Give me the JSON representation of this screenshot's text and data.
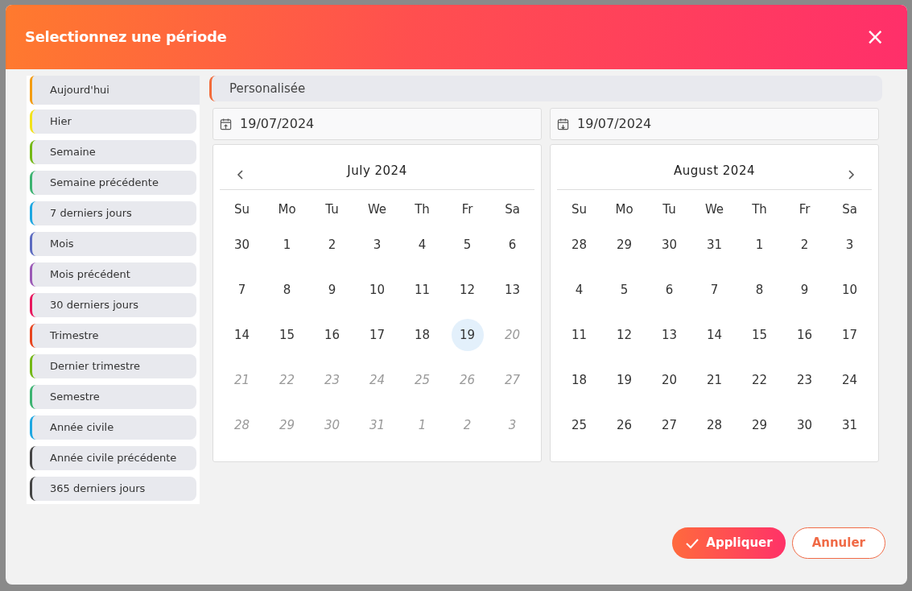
{
  "dialog": {
    "title": "Selectionnez une période",
    "close": "×"
  },
  "presets": [
    {
      "label": "Aujourd'hui",
      "color": "#f39c12",
      "selected": true
    },
    {
      "label": "Hier",
      "color": "#f2e21a",
      "selected": false
    },
    {
      "label": "Semaine",
      "color": "#74b816",
      "selected": false
    },
    {
      "label": "Semaine précédente",
      "color": "#3cb371",
      "selected": false
    },
    {
      "label": "7 derniers jours",
      "color": "#1ea7e1",
      "selected": false
    },
    {
      "label": "Mois",
      "color": "#5c6bc0",
      "selected": false
    },
    {
      "label": "Mois précédent",
      "color": "#9b59b6",
      "selected": false
    },
    {
      "label": "30 derniers jours",
      "color": "#e8175d",
      "selected": false
    },
    {
      "label": "Trimestre",
      "color": "#e8451e",
      "selected": false
    },
    {
      "label": "Dernier trimestre",
      "color": "#74b816",
      "selected": false
    },
    {
      "label": "Semestre",
      "color": "#3cb371",
      "selected": false
    },
    {
      "label": "Année civile",
      "color": "#1ea7e1",
      "selected": false
    },
    {
      "label": "Année civile précédente",
      "color": "#444444",
      "selected": false
    },
    {
      "label": "365 derniers jours",
      "color": "#444444",
      "selected": false
    }
  ],
  "custom": {
    "label": "Personalisée",
    "color": "#f26b3a"
  },
  "date_fields": [
    {
      "kind": "start",
      "value": "19/07/2024"
    },
    {
      "kind": "end",
      "value": "19/07/2024"
    }
  ],
  "calendars": [
    {
      "title": "July 2024",
      "prev_button": true,
      "next_button": false,
      "weekdays": [
        "Su",
        "Mo",
        "Tu",
        "We",
        "Th",
        "Fr",
        "Sa"
      ],
      "weeks": [
        [
          {
            "label": "30",
            "muted": false,
            "selected": false
          },
          {
            "label": "1",
            "muted": false,
            "selected": false
          },
          {
            "label": "2",
            "muted": false,
            "selected": false
          },
          {
            "label": "3",
            "muted": false,
            "selected": false
          },
          {
            "label": "4",
            "muted": false,
            "selected": false
          },
          {
            "label": "5",
            "muted": false,
            "selected": false
          },
          {
            "label": "6",
            "muted": false,
            "selected": false
          }
        ],
        [
          {
            "label": "7",
            "muted": false,
            "selected": false
          },
          {
            "label": "8",
            "muted": false,
            "selected": false
          },
          {
            "label": "9",
            "muted": false,
            "selected": false
          },
          {
            "label": "10",
            "muted": false,
            "selected": false
          },
          {
            "label": "11",
            "muted": false,
            "selected": false
          },
          {
            "label": "12",
            "muted": false,
            "selected": false
          },
          {
            "label": "13",
            "muted": false,
            "selected": false
          }
        ],
        [
          {
            "label": "14",
            "muted": false,
            "selected": false
          },
          {
            "label": "15",
            "muted": false,
            "selected": false
          },
          {
            "label": "16",
            "muted": false,
            "selected": false
          },
          {
            "label": "17",
            "muted": false,
            "selected": false
          },
          {
            "label": "18",
            "muted": false,
            "selected": false
          },
          {
            "label": "19",
            "muted": false,
            "selected": true
          },
          {
            "label": "20",
            "muted": true,
            "selected": false
          }
        ],
        [
          {
            "label": "21",
            "muted": true,
            "selected": false
          },
          {
            "label": "22",
            "muted": true,
            "selected": false
          },
          {
            "label": "23",
            "muted": true,
            "selected": false
          },
          {
            "label": "24",
            "muted": true,
            "selected": false
          },
          {
            "label": "25",
            "muted": true,
            "selected": false
          },
          {
            "label": "26",
            "muted": true,
            "selected": false
          },
          {
            "label": "27",
            "muted": true,
            "selected": false
          }
        ],
        [
          {
            "label": "28",
            "muted": true,
            "selected": false
          },
          {
            "label": "29",
            "muted": true,
            "selected": false
          },
          {
            "label": "30",
            "muted": true,
            "selected": false
          },
          {
            "label": "31",
            "muted": true,
            "selected": false
          },
          {
            "label": "1",
            "muted": true,
            "selected": false
          },
          {
            "label": "2",
            "muted": true,
            "selected": false
          },
          {
            "label": "3",
            "muted": true,
            "selected": false
          }
        ]
      ]
    },
    {
      "title": "August 2024",
      "prev_button": false,
      "next_button": true,
      "weekdays": [
        "Su",
        "Mo",
        "Tu",
        "We",
        "Th",
        "Fr",
        "Sa"
      ],
      "weeks": [
        [
          {
            "label": "28",
            "muted": false,
            "selected": false
          },
          {
            "label": "29",
            "muted": false,
            "selected": false
          },
          {
            "label": "30",
            "muted": false,
            "selected": false
          },
          {
            "label": "31",
            "muted": false,
            "selected": false
          },
          {
            "label": "1",
            "muted": false,
            "selected": false
          },
          {
            "label": "2",
            "muted": false,
            "selected": false
          },
          {
            "label": "3",
            "muted": false,
            "selected": false
          }
        ],
        [
          {
            "label": "4",
            "muted": false,
            "selected": false
          },
          {
            "label": "5",
            "muted": false,
            "selected": false
          },
          {
            "label": "6",
            "muted": false,
            "selected": false
          },
          {
            "label": "7",
            "muted": false,
            "selected": false
          },
          {
            "label": "8",
            "muted": false,
            "selected": false
          },
          {
            "label": "9",
            "muted": false,
            "selected": false
          },
          {
            "label": "10",
            "muted": false,
            "selected": false
          }
        ],
        [
          {
            "label": "11",
            "muted": false,
            "selected": false
          },
          {
            "label": "12",
            "muted": false,
            "selected": false
          },
          {
            "label": "13",
            "muted": false,
            "selected": false
          },
          {
            "label": "14",
            "muted": false,
            "selected": false
          },
          {
            "label": "15",
            "muted": false,
            "selected": false
          },
          {
            "label": "16",
            "muted": false,
            "selected": false
          },
          {
            "label": "17",
            "muted": false,
            "selected": false
          }
        ],
        [
          {
            "label": "18",
            "muted": false,
            "selected": false
          },
          {
            "label": "19",
            "muted": false,
            "selected": false
          },
          {
            "label": "20",
            "muted": false,
            "selected": false
          },
          {
            "label": "21",
            "muted": false,
            "selected": false
          },
          {
            "label": "22",
            "muted": false,
            "selected": false
          },
          {
            "label": "23",
            "muted": false,
            "selected": false
          },
          {
            "label": "24",
            "muted": false,
            "selected": false
          }
        ],
        [
          {
            "label": "25",
            "muted": false,
            "selected": false
          },
          {
            "label": "26",
            "muted": false,
            "selected": false
          },
          {
            "label": "27",
            "muted": false,
            "selected": false
          },
          {
            "label": "28",
            "muted": false,
            "selected": false
          },
          {
            "label": "29",
            "muted": false,
            "selected": false
          },
          {
            "label": "30",
            "muted": false,
            "selected": false
          },
          {
            "label": "31",
            "muted": false,
            "selected": false
          }
        ]
      ]
    }
  ],
  "buttons": [
    {
      "kind": "primary",
      "label": "Appliquer"
    },
    {
      "kind": "secondary",
      "label": "Annuler"
    }
  ]
}
